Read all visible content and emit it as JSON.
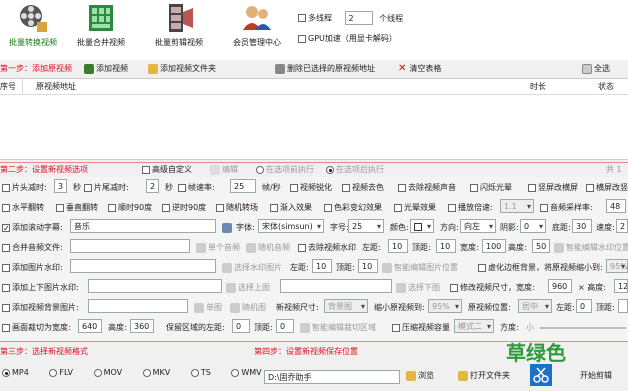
{
  "toolbar": {
    "btn1": "批量转换视频",
    "btn2": "批量合并视频",
    "btn3": "批量剪辑视频",
    "btn4": "会员管理中心",
    "multithread_label": "多线程",
    "thread_count": "2",
    "thread_unit": "个线程",
    "gpu_label": "GPU加速（用显卡解码）"
  },
  "step1": {
    "title": "第一步：添加原视频",
    "add_video": "添加视频",
    "add_folder": "添加视频文件夹",
    "delete_selected": "删除已选择的原视频地址",
    "clear_table": "清空表格",
    "select_all": "全选",
    "col_index": "序号",
    "col_path": "原视频地址",
    "col_duration": "时长",
    "col_status": "状态"
  },
  "step2": {
    "title": "第二步：设置新视频选项",
    "advanced": "高级自定义",
    "edit": "编辑",
    "before_exec": "在选项前执行",
    "after_exec": "在选项后执行",
    "count": "共 1"
  },
  "options": {
    "r1": {
      "head_cut": "片头减时:",
      "head_val": "3",
      "sec1": "秒",
      "tail_cut": "片尾减时:",
      "tail_val": "2",
      "sec2": "秒",
      "fps_label": "帧速率:",
      "fps_val": "25",
      "fps_unit": "帧/秒",
      "sharpen": "视频锐化",
      "decolor": "视频去色",
      "mute": "去除视频声音",
      "flash": "闪烁光晕",
      "vertical": "竖屏改横屏",
      "horizontal": "横屏改竖"
    },
    "r2": {
      "hflip": "水平翻转",
      "vflip": "垂直翻转",
      "rot90": "顺时90度",
      "rot90r": "逆时90度",
      "random_trans": "随机转场",
      "fadein": "渐入效果",
      "color_change": "色彩变幻效果",
      "light": "光晕效果",
      "speed_label": "播放倍速:",
      "speed_val": "1.1",
      "samplerate": "音频采样率:",
      "samplerate_val": "48"
    },
    "r3": {
      "add_sub": "添加滚动字幕:",
      "sub_val": "音乐",
      "font_label": "字体:",
      "font_val": "宋体(simsun)",
      "size_label": "字号:",
      "size_val": "25",
      "color_label": "颜色:",
      "dir_label": "方向:",
      "dir_val": "向左",
      "shadow_label": "阴影:",
      "shadow_val": "0",
      "bottom_label": "底距:",
      "bottom_val": "30",
      "speed_label": "速度:",
      "speed_val": "2"
    },
    "r4": {
      "merge_audio": "合并音频文件:",
      "single_audio": "单个音频",
      "random_audio": "随机音频",
      "remove_wm": "去除视频水印",
      "left_label": "左距:",
      "left_val": "10",
      "top_label": "顶距:",
      "top_val": "10",
      "w_label": "宽度:",
      "w_val": "100",
      "h_label": "高度:",
      "h_val": "50",
      "smart": "智能编辑水印位置"
    },
    "r5": {
      "add_wm_img": "添加图片水印:",
      "choose_wm": "选择水印图片",
      "left_label": "左距:",
      "left_val": "10",
      "top_label": "顶距:",
      "top_val": "10",
      "smart": "智能编辑图片位置",
      "blur_bg": "虚化边框背景，将原视频缩小到:",
      "blur_val": "95%"
    },
    "r6": {
      "add_topbottom": "添加上下图片水印:",
      "choose_top": "选择上图",
      "choose_bottom": "选择下图",
      "modify_size": "修改视频尺寸，宽度:",
      "width_val": "960",
      "height_label": "× 高度:",
      "height_val": "12"
    },
    "r7": {
      "add_bg": "添加视频背景图片:",
      "single": "单图",
      "random": "随机图",
      "new_size": "新视频尺寸:",
      "new_size_val": "背景图",
      "shrink": "缩小原视频到:",
      "shrink_val": "95%",
      "orig_pos": "原视频位置:",
      "orig_pos_val": "居中",
      "left_label": "左距:",
      "left_val": "0",
      "top_label": "顶距:"
    },
    "r8": {
      "crop": "画面裁切为宽度:",
      "crop_w": "640",
      "crop_h_label": "高度:",
      "crop_h": "360",
      "keep_left": "保留区域的左距:",
      "keep_left_val": "0",
      "keep_top": "顶距:",
      "keep_top_val": "0",
      "smart": "智能编辑裁切区域",
      "compress": "压缩视频容量",
      "mode": "模式二",
      "quality_label": "方度:",
      "quality_small": "小"
    }
  },
  "step3": {
    "title": "第三步：选择新视频格式",
    "formats": [
      "MP4",
      "FLV",
      "MOV",
      "MKV",
      "TS",
      "WMV"
    ]
  },
  "step4": {
    "title": "第四步：设置新视频保存位置",
    "path": "D:\\固乔助手",
    "browse": "浏览",
    "open_folder": "打开文件夹",
    "start": "开始剪辑",
    "watermark": "草绿色"
  },
  "colors": {
    "accent_red": "#d01010",
    "grass_green": "#2e9a3a"
  }
}
